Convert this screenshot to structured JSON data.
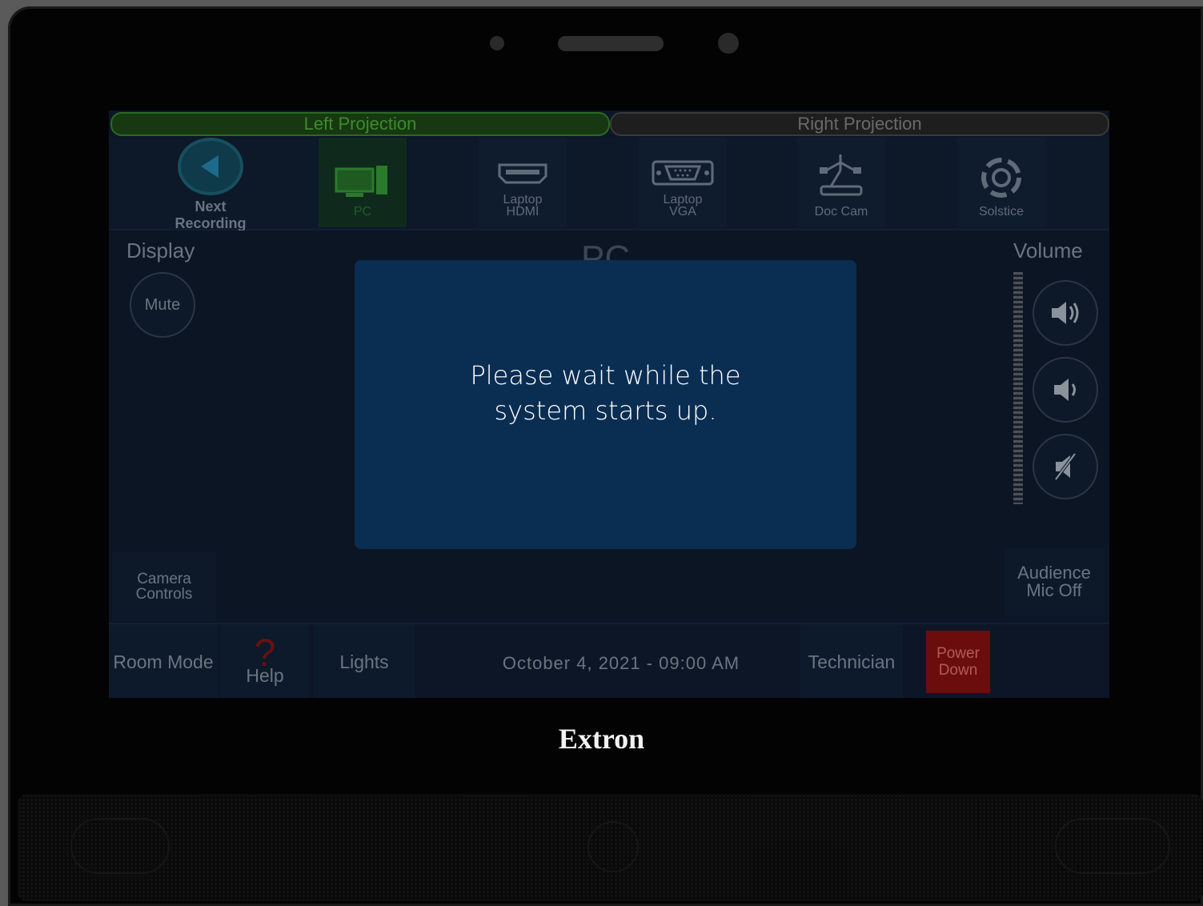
{
  "tabs": {
    "left": "Left Projection",
    "right": "Right Projection"
  },
  "sources": {
    "next_recording": "Next\nRecording",
    "pc": "PC",
    "laptop_hdmi": "Laptop\nHDMI",
    "laptop_vga": "Laptop\nVGA",
    "doc_cam": "Doc Cam",
    "solstice": "Solstice"
  },
  "display": {
    "title": "Display",
    "mute": "Mute",
    "current_source": "PC"
  },
  "volume": {
    "title": "Volume"
  },
  "camera_controls": "Camera\nControls",
  "audience_mic": "Audience\nMic Off",
  "bottom": {
    "room_mode": "Room Mode",
    "help": "Help",
    "lights": "Lights",
    "datetime": "October 4, 2021 - 09:00 AM",
    "technician": "Technician",
    "power_down": "Power\nDown"
  },
  "modal": {
    "message": "Please wait while the system starts up."
  },
  "brand": "Extron",
  "colors": {
    "modal_bg": "#0a2d52",
    "active_tab": "#173812",
    "power_button": "#6b0d0d"
  }
}
